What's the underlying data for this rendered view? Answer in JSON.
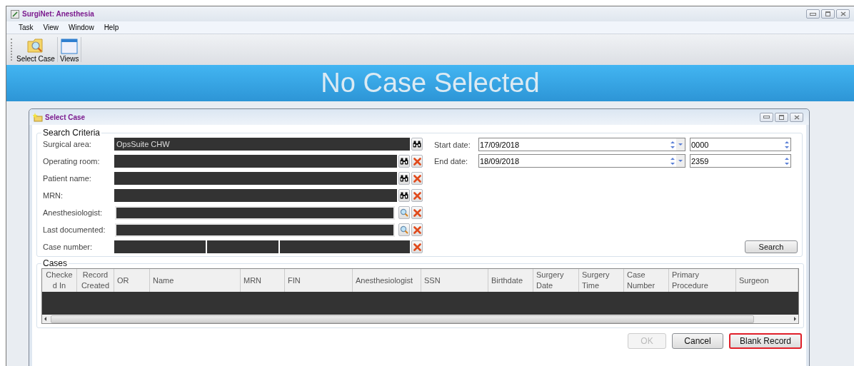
{
  "window": {
    "title": "SurgiNet: Anesthesia"
  },
  "menu": [
    "Task",
    "View",
    "Window",
    "Help"
  ],
  "toolbar": [
    {
      "label": "Select Case",
      "kind": "folder"
    },
    {
      "label": "Views",
      "kind": "window"
    }
  ],
  "banner": "No Case Selected",
  "dialog": {
    "title": "Select Case",
    "search_criteria": {
      "title": "Search Criteria",
      "fields": [
        {
          "label": "Surgical area:",
          "value": "OpsSuite CHW",
          "kind": "search",
          "clearable": false
        },
        {
          "label": "Operating room:",
          "kind": "search",
          "clearable": true
        },
        {
          "label": "Patient name:",
          "kind": "search",
          "clearable": true
        },
        {
          "label": "MRN:",
          "kind": "search",
          "clearable": true
        },
        {
          "label": "Anesthesiologist:",
          "kind": "lookup",
          "clearable": true
        },
        {
          "label": "Last documented:",
          "kind": "lookup",
          "clearable": true
        },
        {
          "label": "Case number:",
          "kind": "segmented",
          "clearable": true
        }
      ],
      "dates": [
        {
          "label": "Start date:",
          "date": "17/09/2018",
          "time": "0000"
        },
        {
          "label": "End date:",
          "date": "18/09/2018",
          "time": "2359"
        }
      ],
      "search_button": "Search"
    },
    "cases": {
      "title": "Cases",
      "columns": [
        "Checke d In",
        "Record Created",
        "OR",
        "Name",
        "MRN",
        "FIN",
        "Anesthesiologist",
        "SSN",
        "Birthdate",
        "Surgery Date",
        "Surgery Time",
        "Case Number",
        "Primary Procedure",
        "Surgeon"
      ]
    },
    "buttons": [
      {
        "label": "OK",
        "disabled": true,
        "focused": false
      },
      {
        "label": "Cancel",
        "disabled": false,
        "focused": false
      },
      {
        "label": "Blank Record",
        "disabled": false,
        "focused": true
      }
    ]
  }
}
